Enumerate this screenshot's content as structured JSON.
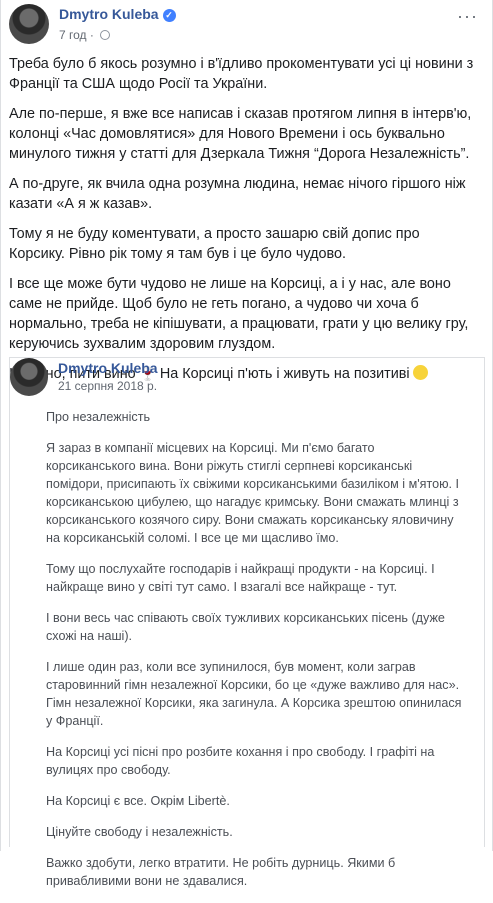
{
  "post": {
    "author": "Dmytro Kuleba",
    "time": "7 год",
    "more_label": "···",
    "paragraphs": [
      "Треба було б якось розумно і в'їдливо прокоментувати усі ці новини з Франції та США щодо Росії та України.",
      "Але по-перше, я вже все написав і сказав протягом липня в інтерв'ю, колонці «Час домовлятися» для Нового Времени і ось буквально минулого тижня у статті для Дзеркала Тижня “Дорога Незалежність”.",
      "А по-друге, як вчила одна розумна людина, немає нічого гіршого ніж казати «А я ж казав».",
      "Тому я не буду коментувати, а просто зашарю свій допис про Корсику. Рівно рік тому я там був і це було чудово.",
      "І все ще може бути чудово не лише на Корсиці, а і у нас, але воно саме не прийде. Щоб було не геть погано, а чудово чи хоча б нормально, треба не кіпішувати, а працювати, грати у цю велику гру, керуючись зухвалим здоровим глуздом."
    ],
    "last_a": "І, звісно, пити вино",
    "last_b": " На Корсиці п'ють і живуть на позитиві",
    "wine_icon": "🍷"
  },
  "shared": {
    "author": "Dmytro Kuleba",
    "date": "21 серпня 2018 р.",
    "paragraphs": [
      "Про незалежність",
      "Я зараз в компанії місцевих на Корсиці. Ми п'ємо багато корсиканського вина. Вони ріжуть стиглі серпневі корсиканські помідори, присипають їх свіжими корсиканськими базиліком і м'ятою. І корсиканською цибулею, що нагадує кримську. Вони смажать млинці з корсиканського козячого сиру. Вони смажать корсиканську яловичину на корсиканській соломі. І все це ми щасливо їмо.",
      "Тому що послухайте господарів і найкращі продукти - на Корсиці. І найкраще вино у світі тут само. І взагалі все найкраще - тут.",
      "І вони весь час співають своїх тужливих корсиканських пісень (дуже схожі на наші).",
      "І лише один раз, коли все зупинилося, був момент, коли заграв старовинний гімн незалежної Корсики, бо це «дуже важливо для нас». Гімн незалежної Корсики, яка загинула. А Корсика зрештою опинилася у Франції.",
      "На Корсиці усі пісні про розбите кохання і про свободу. І графіті на вулицях про свободу.",
      "На Корсиці є все. Окрім Libertè.",
      "Цінуйте свободу і незалежність.",
      "Важко здобути, легко втратити. Не робіть дурниць. Якими б привабливими вони не здавалися."
    ]
  }
}
